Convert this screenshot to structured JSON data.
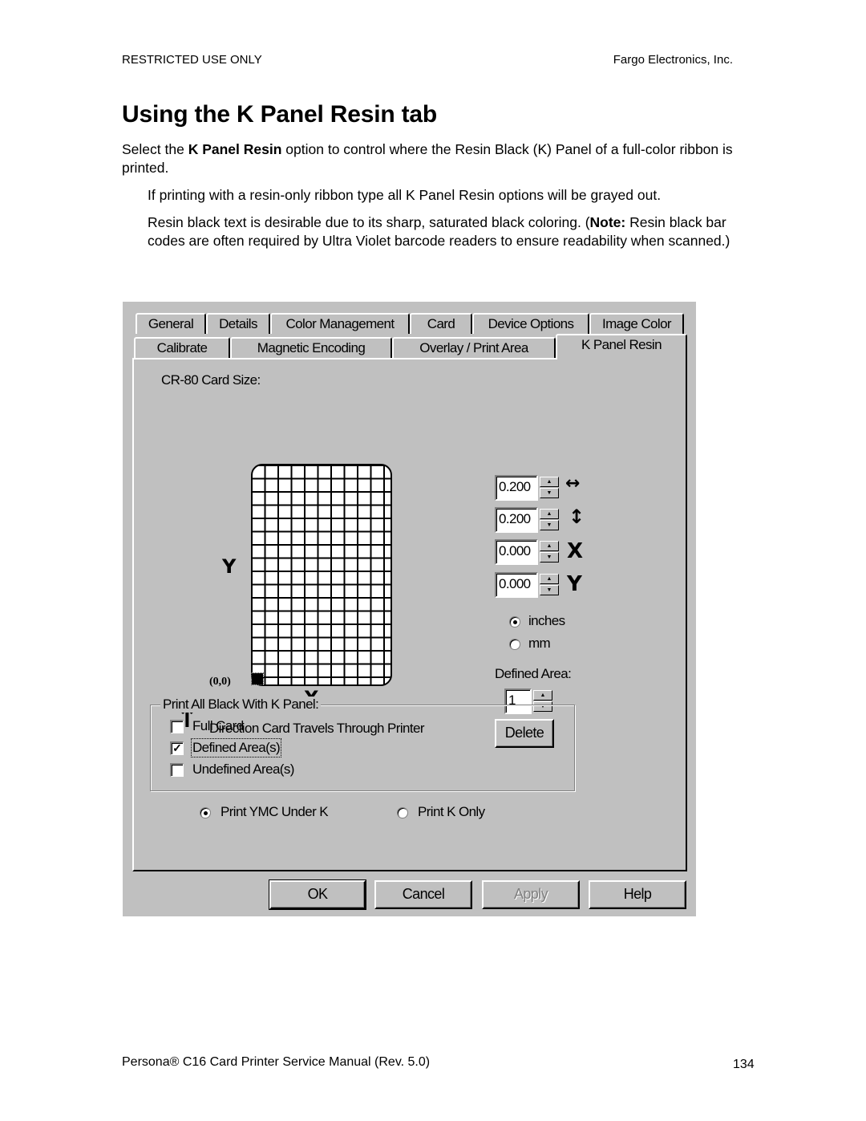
{
  "header": {
    "left": "RESTRICTED USE ONLY",
    "right": "Fargo Electronics, Inc."
  },
  "title": "Using the K Panel Resin tab",
  "paragraphs": {
    "p1_pre": "Select the ",
    "p1_bold": "K Panel Resin",
    "p1_post": " option to control where the Resin Black (K) Panel of a full-color ribbon is printed.",
    "p2": "If printing with a resin-only ribbon type all K Panel Resin options will be grayed out.",
    "p3_pre": "Resin black text is desirable due to its sharp, saturated black coloring. (",
    "p3_bold": "Note:",
    "p3_post": "  Resin black bar codes are often required by Ultra Violet barcode readers to ensure readability when scanned.)"
  },
  "dialog": {
    "tabs_row1": [
      "General",
      "Details",
      "Color Management",
      "Card",
      "Device Options",
      "Image Color"
    ],
    "tabs_row2": [
      "Calibrate",
      "Magnetic Encoding",
      "Overlay / Print Area",
      "K Panel Resin"
    ],
    "active_tab": "K Panel Resin",
    "card_size_label": "CR-80 Card Size:",
    "axis_y": "Y",
    "axis_x": "X",
    "origin_label": "(0,0)",
    "direction_label": "Direction Card Travels Through Printer",
    "spinners": [
      {
        "name": "width",
        "value": "0.200",
        "icon": "width-arrows-icon"
      },
      {
        "name": "height",
        "value": "0.200",
        "icon": "height-arrows-icon"
      },
      {
        "name": "x",
        "value": "0.000",
        "icon": "x-offset-icon"
      },
      {
        "name": "y",
        "value": "0.000",
        "icon": "y-offset-icon"
      }
    ],
    "spinner_icons": {
      "width": "↔",
      "height": "↕",
      "x": "X",
      "y": "Y"
    },
    "units": {
      "inches_label": "inches",
      "mm_label": "mm",
      "selected": "inches"
    },
    "defined_area_label": "Defined Area:",
    "defined_area_value": "1",
    "delete_label": "Delete",
    "group_title": "Print All Black With K Panel:",
    "checkboxes": [
      {
        "label": "Full Card",
        "checked": false
      },
      {
        "label": "Defined Area(s)",
        "checked": true
      },
      {
        "label": "Undefined Area(s)",
        "checked": false
      }
    ],
    "print_mode": {
      "ymc_label": "Print YMC Under K",
      "k_only_label": "Print K Only",
      "selected": "Print YMC Under K"
    },
    "buttons": {
      "ok": "OK",
      "cancel": "Cancel",
      "apply": "Apply",
      "help": "Help"
    }
  },
  "footer": {
    "left": "Persona® C16 Card Printer Service Manual (Rev. 5.0)",
    "page": "134"
  }
}
